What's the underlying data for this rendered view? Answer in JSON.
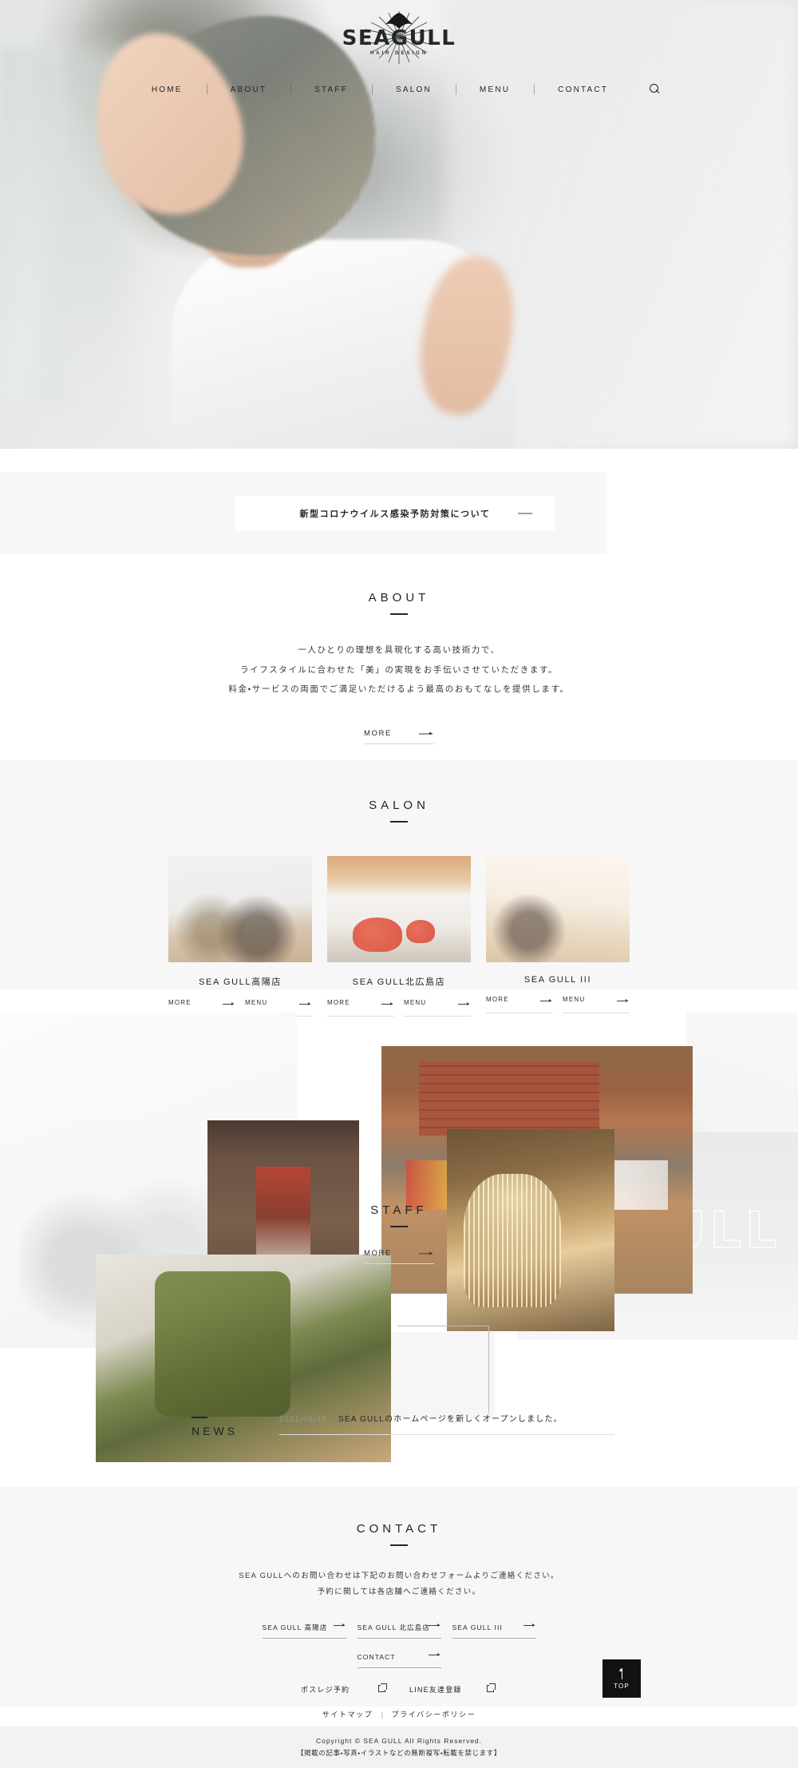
{
  "site": {
    "logo_word": "SEAGULL",
    "logo_sub": "HAIR DESIGN"
  },
  "nav": {
    "items": [
      {
        "label": "HOME"
      },
      {
        "label": "ABOUT"
      },
      {
        "label": "STAFF"
      },
      {
        "label": "SALON"
      },
      {
        "label": "MENU"
      },
      {
        "label": "CONTACT"
      }
    ],
    "search_icon": "search-icon"
  },
  "banner": {
    "text": "新型コロナウイルス感染予防対策について",
    "arrow": "→"
  },
  "about": {
    "title": "ABOUT",
    "lines": [
      "一人ひとりの理想を具現化する高い技術力で、",
      "ライフスタイルに合わせた「美」の実現をお手伝いさせていただきます。",
      "料金・サービスの両面でご満足いただけるよう最高のおもてなしを提供します。"
    ],
    "more_label": "MORE"
  },
  "salon": {
    "title": "SALON",
    "cards": [
      {
        "name": "SEA GULL高陽店",
        "more_label": "MORE",
        "menu_label": "MENU"
      },
      {
        "name": "SEA GULL北広島店",
        "more_label": "MORE",
        "menu_label": "MENU"
      },
      {
        "name": "SEA GULL III",
        "more_label": "MORE",
        "menu_label": "MENU"
      }
    ]
  },
  "staff": {
    "title": "STAFF",
    "more_label": "MORE",
    "watermark_word": "EAGULL"
  },
  "news": {
    "label": "NEWS",
    "items": [
      {
        "date": "2021/06/10",
        "title": "SEA GULLのホームページを新しくオープンしました。"
      }
    ]
  },
  "contact": {
    "title": "CONTACT",
    "desc_lines": [
      "SEA GULLへのお問い合わせは下記のお問い合わせフォームよりご連絡ください。",
      "予約に関しては各店舗へご連絡ください。"
    ],
    "shop_links": [
      {
        "label": "SEA GULL 高陽店"
      },
      {
        "label": "SEA GULL 北広島店"
      },
      {
        "label": "SEA GULL III"
      }
    ],
    "form_link": {
      "label": "CONTACT"
    },
    "external_links": [
      {
        "label": "ポスレジ予約"
      },
      {
        "label": "LINE友達登録"
      }
    ]
  },
  "top_button": {
    "label": "TOP"
  },
  "footer": {
    "sitemap_label": "サイトマップ",
    "separator": "|",
    "privacy_label": "プライバシーポリシー",
    "copyright_line1": "Copyright © SEA GULL All Rights Reserved.",
    "copyright_line2": "【掲載の記事・写真・イラストなどの無断複写・転載を禁じます】"
  }
}
